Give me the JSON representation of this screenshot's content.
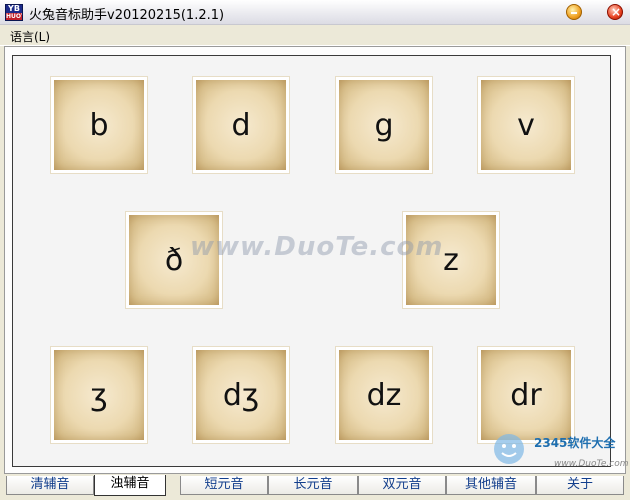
{
  "window": {
    "title": "火兔音标助手v20120215(1.2.1)",
    "icon_label_top": "YB",
    "icon_label_bottom": "HUOTU"
  },
  "menu": {
    "language_label": "语言(L)"
  },
  "cards": [
    {
      "symbol": "b"
    },
    {
      "symbol": "d"
    },
    {
      "symbol": "g"
    },
    {
      "symbol": "v"
    },
    {
      "symbol": "ð"
    },
    {
      "symbol": "z"
    },
    {
      "symbol": "ʒ"
    },
    {
      "symbol": "dʒ"
    },
    {
      "symbol": "dz"
    },
    {
      "symbol": "dr"
    }
  ],
  "tabs": [
    {
      "label": "清辅音",
      "active": false
    },
    {
      "label": "浊辅音",
      "active": true
    },
    {
      "label": "短元音",
      "active": false
    },
    {
      "label": "长元音",
      "active": false
    },
    {
      "label": "双元音",
      "active": false
    },
    {
      "label": "其他辅音",
      "active": false
    },
    {
      "label": "关于",
      "active": false
    }
  ],
  "watermarks": {
    "center": "www.DuoTe.com",
    "brand_name": "2345软件大全",
    "brand_url": "www.DuoTe.com"
  }
}
